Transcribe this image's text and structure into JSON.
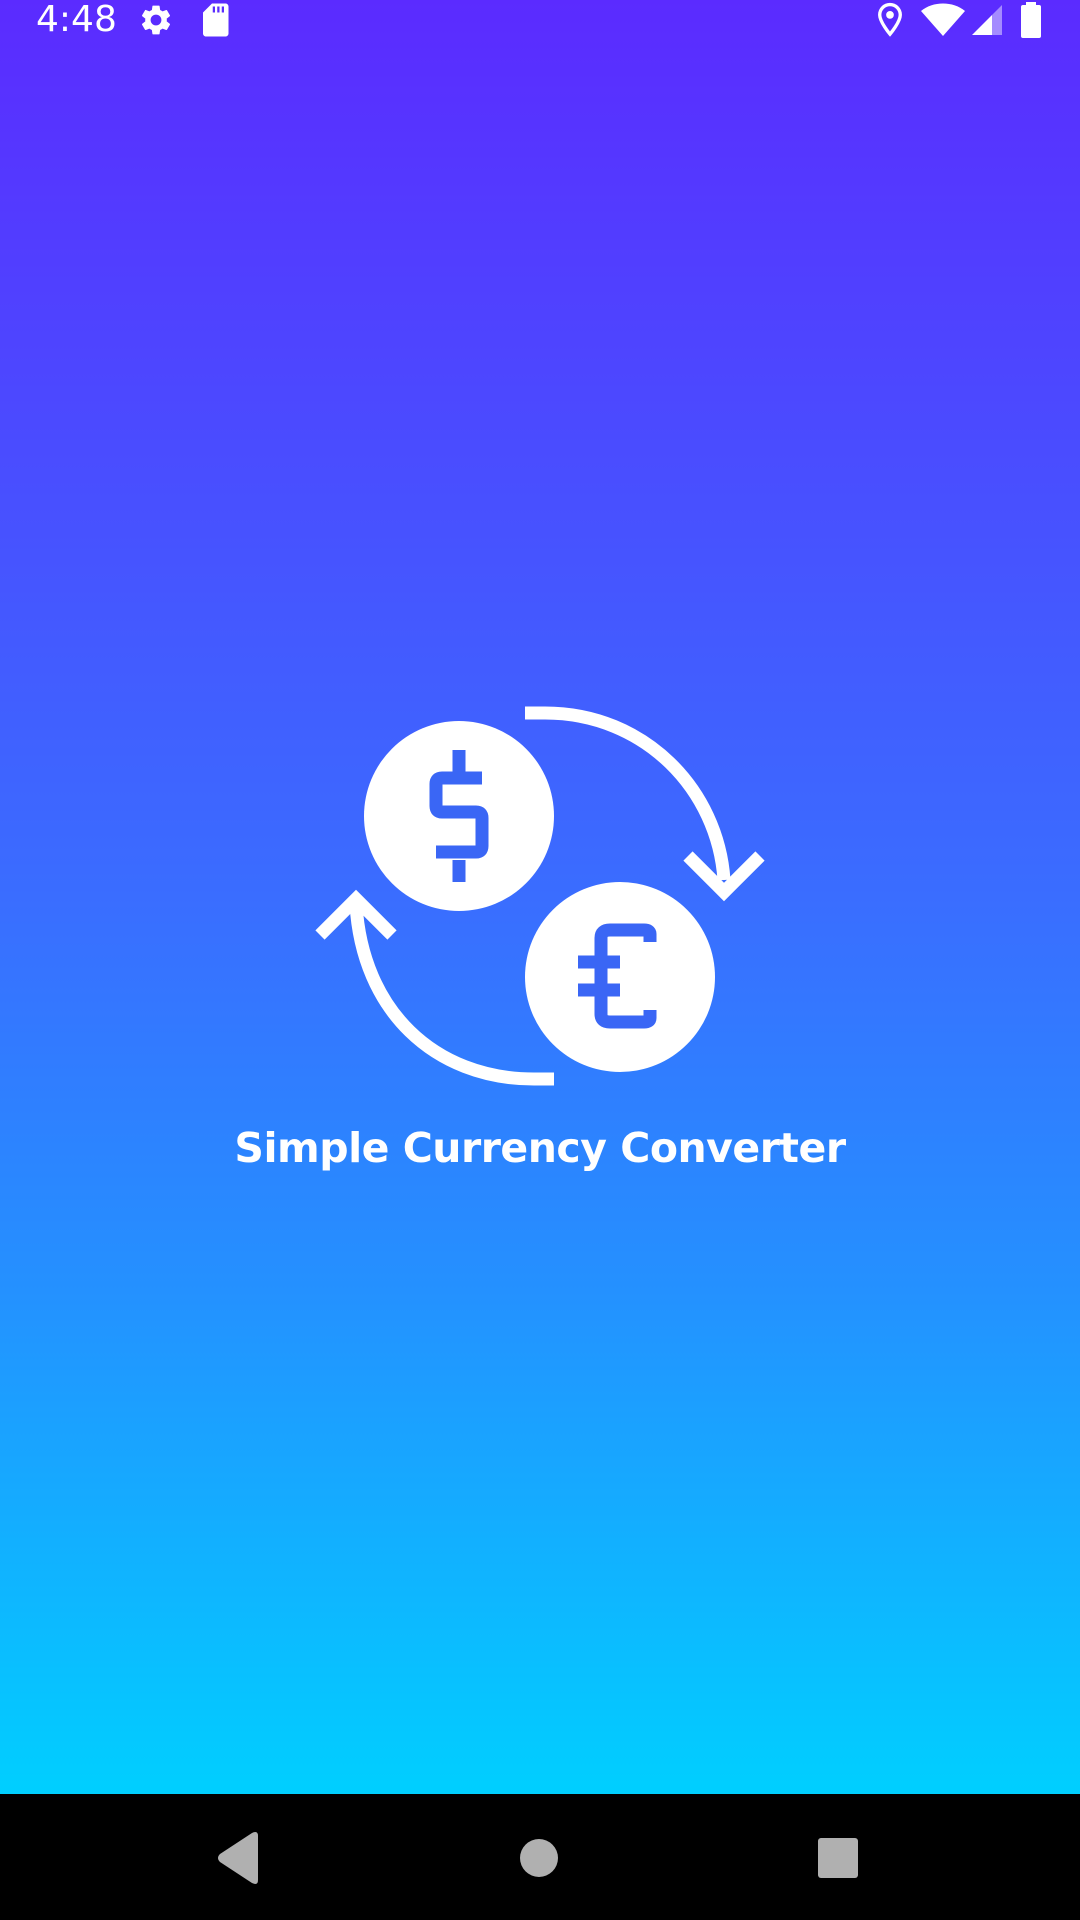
{
  "status_bar": {
    "time": "4:48",
    "icons": [
      "settings-icon",
      "sd-card-icon",
      "location-icon",
      "wifi-icon",
      "cellular-signal-icon",
      "battery-icon"
    ]
  },
  "splash": {
    "title": "Simple Currency Converter",
    "logo_icon": "currency-exchange-icon",
    "symbols": [
      "$",
      "€"
    ]
  },
  "navigation": {
    "buttons": [
      "back-icon",
      "home-icon",
      "recents-icon"
    ]
  },
  "colors": {
    "gradient_top": "#5b2bff",
    "gradient_bottom": "#00cfff",
    "logo_fill": "#ffffff",
    "symbol_color": "#3a66f5",
    "nav_button": "#b0b0b0"
  }
}
